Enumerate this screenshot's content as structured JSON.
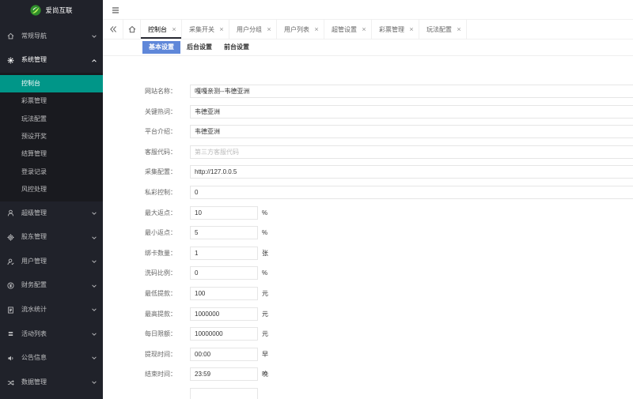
{
  "logo": {
    "text": "爱尚互联",
    "icon": "logo-icon"
  },
  "sidebar": {
    "items": [
      {
        "label": "常规导航",
        "icon": "home-icon"
      },
      {
        "label": "系统管理",
        "icon": "gear-icon",
        "expanded": true,
        "children": [
          {
            "label": "控制台",
            "active": true
          },
          {
            "label": "彩票管理"
          },
          {
            "label": "玩法配置"
          },
          {
            "label": "预设开奖"
          },
          {
            "label": "结算管理"
          },
          {
            "label": "登录记录"
          },
          {
            "label": "风控处理"
          }
        ]
      },
      {
        "label": "超级管理",
        "icon": "user-icon"
      },
      {
        "label": "股东管理",
        "icon": "cog-icon"
      },
      {
        "label": "用户管理",
        "icon": "user-badge-icon"
      },
      {
        "label": "财务配置",
        "icon": "money-circle-icon"
      },
      {
        "label": "流水统计",
        "icon": "document-icon"
      },
      {
        "label": "活动列表",
        "icon": "layers-icon"
      },
      {
        "label": "公告信息",
        "icon": "speaker-icon"
      },
      {
        "label": "数据管理",
        "icon": "shuffle-icon"
      }
    ]
  },
  "header": {
    "menu_icon": "hamburger-icon"
  },
  "tabbar": {
    "left_icon": "double-chevron-left-icon",
    "home_icon": "home-icon",
    "close_icon": "close-icon",
    "tabs": [
      {
        "label": "控制台",
        "active": true
      },
      {
        "label": "采集开关"
      },
      {
        "label": "用户分组"
      },
      {
        "label": "用户列表"
      },
      {
        "label": "超管设置"
      },
      {
        "label": "彩票管理"
      },
      {
        "label": "玩法配置"
      }
    ]
  },
  "subtabs": [
    {
      "label": "基本设置",
      "active": true
    },
    {
      "label": "后台设置"
    },
    {
      "label": "前台设置"
    }
  ],
  "form": {
    "fields": [
      {
        "label": "网站名称：",
        "value": "嘎嘎亲测--韦德亚洲"
      },
      {
        "label": "关键热词：",
        "value": "韦德亚洲"
      },
      {
        "label": "平台介绍：",
        "value": "韦德亚洲"
      },
      {
        "label": "客服代码：",
        "placeholder": "第三方客服代码"
      },
      {
        "label": "采集配置：",
        "value": "http://127.0.0.5"
      },
      {
        "label": "私彩控制：",
        "value": "0"
      },
      {
        "label": "最大返点：",
        "value": "10",
        "unit": "%"
      },
      {
        "label": "最小返点：",
        "value": "5",
        "unit": "%"
      },
      {
        "label": "绑卡数量：",
        "value": "1",
        "unit": "张"
      },
      {
        "label": "洗码比例：",
        "value": "0",
        "unit": "%"
      },
      {
        "label": "最低提款：",
        "value": "100",
        "unit": "元"
      },
      {
        "label": "最高提款：",
        "value": "1000000",
        "unit": "元"
      },
      {
        "label": "每日限额：",
        "value": "10000000",
        "unit": "元"
      },
      {
        "label": "提现时间：",
        "value": "00:00",
        "unit": "早"
      },
      {
        "label": "结束时间：",
        "value": "23:59",
        "unit": "晚"
      }
    ]
  },
  "colors": {
    "sidebar_bg": "#20222a",
    "submenu_bg": "#191a1f",
    "active": "#009688",
    "subtab_active": "#5f87d9",
    "tab_underline": "#292b34"
  }
}
